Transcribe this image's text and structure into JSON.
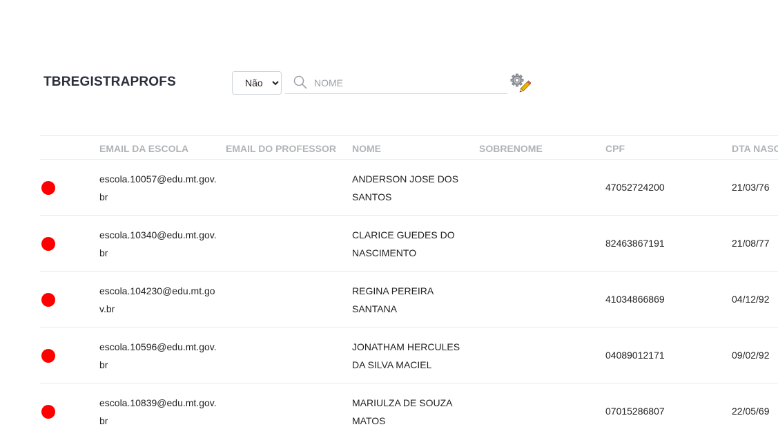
{
  "header": {
    "title": "TBREGISTRAPROFS",
    "filter_select": {
      "selected": "Não",
      "options": [
        "Não"
      ]
    },
    "search": {
      "placeholder": "NOME",
      "value": ""
    },
    "settings_icon": "gear-pencil-icon"
  },
  "table": {
    "columns": {
      "email_escola": "EMAIL DA ESCOLA",
      "email_professor": "EMAIL DO PROFESSOR",
      "nome": "NOME",
      "sobrenome": "SOBRENOME",
      "cpf": "CPF",
      "dta_nasc": "DTA NASC"
    },
    "status_color": "#ff0000",
    "rows": [
      {
        "email_escola": "escola.10057@edu.mt.gov.br",
        "email_professor": "",
        "nome": "ANDERSON JOSE DOS SANTOS",
        "sobrenome": "",
        "cpf": "47052724200",
        "dta_nasc": "21/03/76"
      },
      {
        "email_escola": "escola.10340@edu.mt.gov.br",
        "email_professor": "",
        "nome": "CLARICE GUEDES DO NASCIMENTO",
        "sobrenome": "",
        "cpf": "82463867191",
        "dta_nasc": "21/08/77"
      },
      {
        "email_escola": "escola.104230@edu.mt.gov.br",
        "email_professor": "",
        "nome": "REGINA PEREIRA SANTANA",
        "sobrenome": "",
        "cpf": "41034866869",
        "dta_nasc": "04/12/92"
      },
      {
        "email_escola": "escola.10596@edu.mt.gov.br",
        "email_professor": "",
        "nome": "JONATHAM HERCULES DA SILVA MACIEL",
        "sobrenome": "",
        "cpf": "04089012171",
        "dta_nasc": "09/02/92"
      },
      {
        "email_escola": "escola.10839@edu.mt.gov.br",
        "email_professor": "",
        "nome": "MARIULZA DE SOUZA MATOS",
        "sobrenome": "",
        "cpf": "07015286807",
        "dta_nasc": "22/05/69"
      }
    ]
  }
}
